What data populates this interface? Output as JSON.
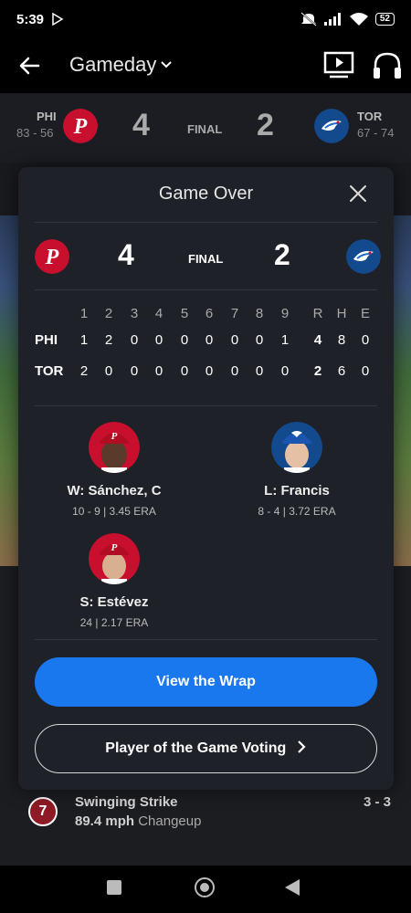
{
  "status_bar": {
    "time": "5:39",
    "battery": "52"
  },
  "app_bar": {
    "title": "Gameday"
  },
  "score_strip": {
    "away": {
      "abbr": "PHI",
      "record": "83 - 56",
      "score": "4"
    },
    "home": {
      "abbr": "TOR",
      "record": "67 - 74",
      "score": "2"
    },
    "status": "FINAL"
  },
  "modal": {
    "title": "Game Over",
    "away_score": "4",
    "home_score": "2",
    "status": "FINAL",
    "linescore": {
      "headers": [
        "1",
        "2",
        "3",
        "4",
        "5",
        "6",
        "7",
        "8",
        "9",
        "R",
        "H",
        "E"
      ],
      "rows": [
        {
          "team": "PHI",
          "innings": [
            "1",
            "2",
            "0",
            "0",
            "0",
            "0",
            "0",
            "0",
            "1"
          ],
          "rhe": [
            "4",
            "8",
            "0"
          ]
        },
        {
          "team": "TOR",
          "innings": [
            "2",
            "0",
            "0",
            "0",
            "0",
            "0",
            "0",
            "0",
            "0"
          ],
          "rhe": [
            "2",
            "6",
            "0"
          ]
        }
      ]
    },
    "pitchers": {
      "win": {
        "name": "W: Sánchez, C",
        "stats": "10 - 9 | 3.45 ERA"
      },
      "loss": {
        "name": "L: Francis",
        "stats": "8 - 4 | 3.72 ERA"
      },
      "save": {
        "name": "S: Estévez",
        "stats": "24 | 2.17 ERA"
      }
    },
    "wrap_button": "View the Wrap",
    "vote_button": "Player of the Game Voting"
  },
  "pitch": {
    "number": "7",
    "title": "Swinging Strike",
    "speed": "89.4 mph",
    "type": "Changeup",
    "count": "3 - 3"
  },
  "colors": {
    "phillies": "#c8102e",
    "bluejays": "#134a8e",
    "accent": "#1a78ee"
  }
}
